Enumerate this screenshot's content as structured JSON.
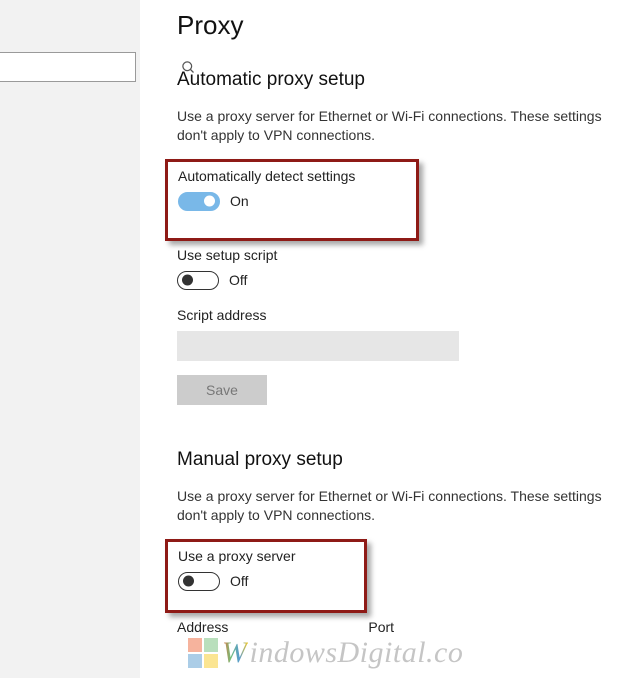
{
  "page_title": "Proxy",
  "search": {
    "placeholder": ""
  },
  "auto": {
    "heading": "Automatic proxy setup",
    "desc": "Use a proxy server for Ethernet or Wi-Fi connections. These settings don't apply to VPN connections.",
    "detect": {
      "label": "Automatically detect settings",
      "state": "On"
    },
    "script": {
      "label": "Use setup script",
      "state": "Off"
    },
    "script_addr_label": "Script address",
    "script_addr_value": "",
    "save_label": "Save"
  },
  "manual": {
    "heading": "Manual proxy setup",
    "desc": "Use a proxy server for Ethernet or Wi-Fi connections. These settings don't apply to VPN connections.",
    "useproxy": {
      "label": "Use a proxy server",
      "state": "Off"
    },
    "address_label": "Address",
    "port_label": "Port"
  },
  "watermark": {
    "w": "W",
    "rest": "indowsDigital.co"
  }
}
